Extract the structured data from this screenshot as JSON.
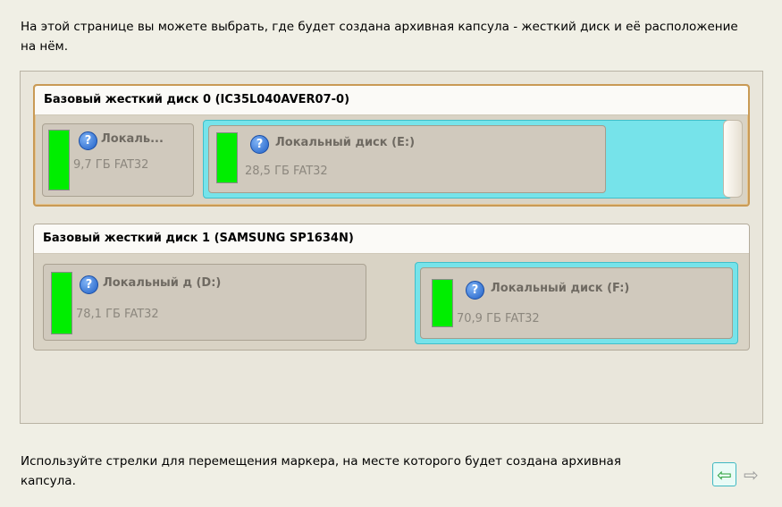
{
  "intro_text": "На этой странице вы можете выбрать, где будет создана архивная капсула - жесткий диск и её расположение на нём.",
  "disks": [
    {
      "title": "Базовый жесткий диск 0 (IC35L040AVER07-0)",
      "partitions": [
        {
          "name": "Локаль...",
          "info": "9,7 ГБ FAT32",
          "selected": false
        },
        {
          "name": "Локальный диск (E:)",
          "info": "28,5 ГБ FAT32",
          "selected": true
        }
      ]
    },
    {
      "title": "Базовый жесткий диск 1 (SAMSUNG SP1634N)",
      "partitions": [
        {
          "name": "Локальный д (D:)",
          "info": "78,1 ГБ FAT32",
          "selected": false
        },
        {
          "name": "Локальный диск (F:)",
          "info": "70,9 ГБ FAT32",
          "selected": true
        }
      ]
    }
  ],
  "footer_text": "Используйте стрелки для перемещения маркера, на месте которого будет создана архивная капсула.",
  "icons": {
    "partition": "help-icon",
    "prev": "arrow-left-icon",
    "next": "arrow-right-icon"
  },
  "colors": {
    "usage_bar": "#00ee00",
    "selection": "#76e3ea",
    "disk_focus": "#c99a55"
  }
}
